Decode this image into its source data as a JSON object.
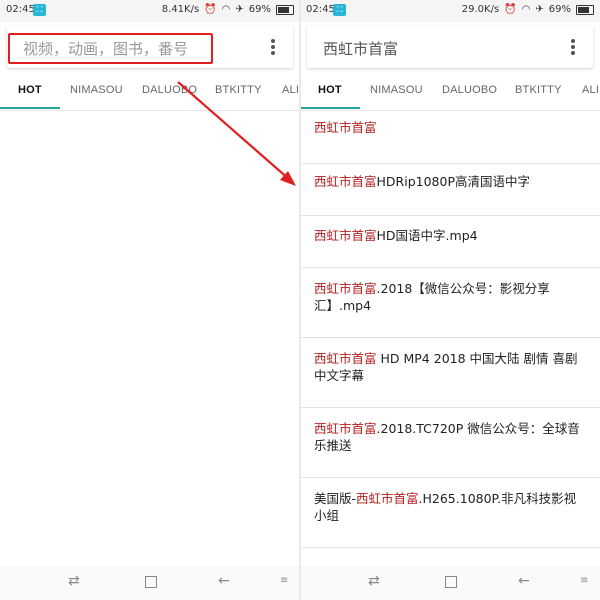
{
  "left": {
    "status": {
      "time": "02:45",
      "speed": "8.41K/s",
      "battery": "69%"
    },
    "search": {
      "placeholder": "视频，动画，图书，番号"
    },
    "tabs": [
      "HOT",
      "NIMASOU",
      "DALUOBO",
      "BTKITTY",
      "ALI"
    ]
  },
  "right": {
    "status": {
      "time": "02:45",
      "speed": "29.0K/s",
      "battery": "69%"
    },
    "search": {
      "value": "西虹市首富"
    },
    "tabs": [
      "HOT",
      "NIMASOU",
      "DALUOBO",
      "BTKITTY",
      "ALI"
    ],
    "results": [
      {
        "pre": "",
        "hl": "西虹市首富",
        "post": ""
      },
      {
        "pre": "",
        "hl": "西虹市首富",
        "post": "HDRip1080P高清国语中字"
      },
      {
        "pre": "",
        "hl": "西虹市首富",
        "post": "HD国语中字.mp4"
      },
      {
        "pre": "",
        "hl": "西虹市首富",
        "post": ".2018【微信公众号：影视分享汇】.mp4"
      },
      {
        "pre": "",
        "hl": "西虹市首富",
        "post": " HD MP4 2018 中国大陆 剧情 喜剧 中文字幕"
      },
      {
        "pre": "",
        "hl": "西虹市首富",
        "post": ".2018.TC720P 微信公众号：全球音乐推送"
      },
      {
        "pre": "美国版-",
        "hl": "西虹市首富",
        "post": ".H265.1080P.非凡科技影视小组"
      },
      {
        "pre": "",
        "hl": "",
        "post": ""
      }
    ]
  },
  "icons": {
    "app_badge": "app-notification-icon",
    "wifi": "wifi-icon",
    "airplane": "airplane-icon",
    "alarm": "alarm-icon",
    "more": "more-vert-icon",
    "recent": "recent-apps-icon",
    "home": "home-icon",
    "back": "back-icon",
    "menu": "menu-icon"
  },
  "colors": {
    "highlight_text": "#b41e1e",
    "annotation_red": "#e02020",
    "tab_indicator": "#26a69a"
  }
}
